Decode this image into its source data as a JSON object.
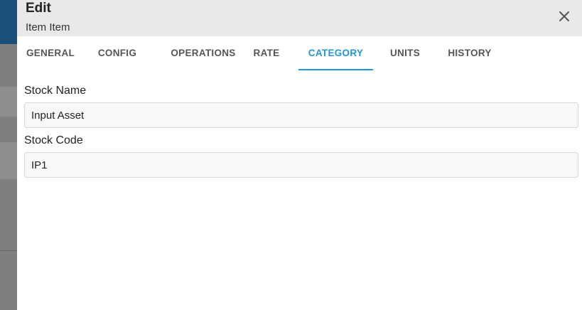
{
  "dialog": {
    "title": "Edit",
    "subtitle": "Item Item"
  },
  "tabs": [
    {
      "label": "GENERAL",
      "active": false
    },
    {
      "label": "CONFIG",
      "active": false
    },
    {
      "label": "OPERATIONS",
      "active": false
    },
    {
      "label": "RATE",
      "active": false
    },
    {
      "label": "CATEGORY",
      "active": true
    },
    {
      "label": "UNITS",
      "active": false
    },
    {
      "label": "HISTORY",
      "active": false
    }
  ],
  "form": {
    "stock_name": {
      "label": "Stock Name",
      "value": "Input Asset"
    },
    "stock_code": {
      "label": "Stock Code",
      "value": "IP1"
    }
  },
  "colors": {
    "accent": "#2196d8",
    "header_bg": "#e8e8e8"
  }
}
